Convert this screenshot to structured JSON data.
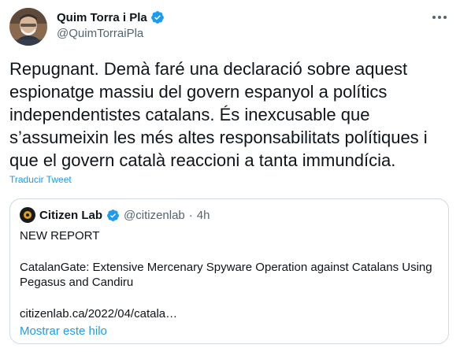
{
  "author": {
    "display_name": "Quim Torra i Pla",
    "handle": "@QuimTorraiPla",
    "verified_icon": "verified-badge-icon",
    "avatar_icon": "profile-photo"
  },
  "more_icon": "more-horizontal-icon",
  "tweet": {
    "text": "Repugnant. Demà faré una declaració sobre aquest\nespionatge massiu del govern espanyol a polítics\nindependentistes catalans. És inexcusable que\ns’assumeixin les més altes responsabilitats polítiques i\nque el govern català reaccioni a tanta immundícia.",
    "translate_label": "Traducir Tweet"
  },
  "quote": {
    "display_name": "Citizen Lab",
    "handle": "@citizenlab",
    "separator": "·",
    "time": "4h",
    "line1": "NEW REPORT",
    "title": "CatalanGate: Extensive Mercenary Spyware Operation against Catalans Using Pegasus and Candiru",
    "link": "citizenlab.ca/2022/04/catala…",
    "show_thread_label": "Mostrar este hilo"
  },
  "colors": {
    "accent": "#1d9bf0",
    "secondary_text": "#536471",
    "border": "#cfd9de"
  }
}
